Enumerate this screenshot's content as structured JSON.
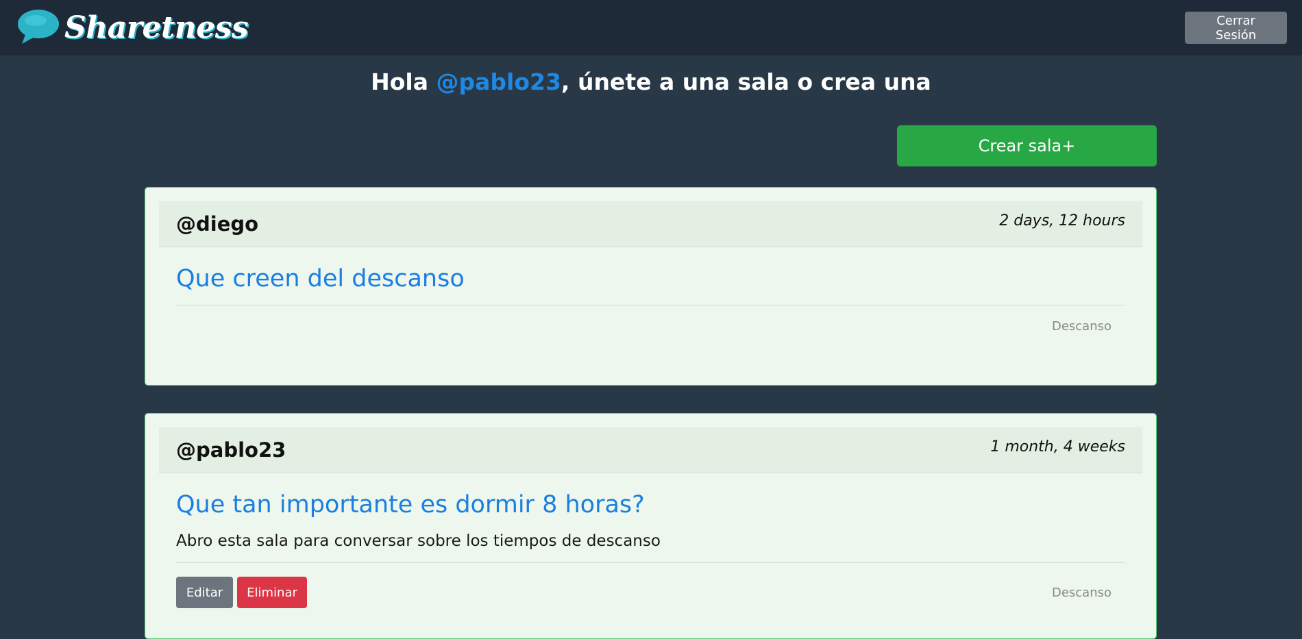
{
  "navbar": {
    "brand_name": "Sharetness",
    "logo_icon": "speech-bubble-icon",
    "logout_label": "Cerrar Sesión"
  },
  "greeting": {
    "prefix": "Hola ",
    "username": "@pablo23",
    "suffix": ", únete a una sala o crea una"
  },
  "create_button_label": "Crear sala+",
  "rooms": [
    {
      "author": "@diego",
      "time": "2 days, 12 hours",
      "title": "Que creen del descanso",
      "description": "",
      "tag": "Descanso"
    },
    {
      "author": "@pablo23",
      "time": "1 month, 4 weeks",
      "title": "Que tan importante es dormir 8 horas?",
      "description": "Abro esta sala para conversar sobre los tiempos de descanso",
      "tag": "Descanso",
      "edit_label": "Editar",
      "delete_label": "Eliminar"
    }
  ],
  "colors": {
    "background": "#283847",
    "navbar": "#1f2a38",
    "accent_link": "#1a7fe0",
    "create_button": "#28a745",
    "delete_button": "#dc3545",
    "secondary_button": "#6c757d",
    "card_background": "#edf7ed"
  }
}
